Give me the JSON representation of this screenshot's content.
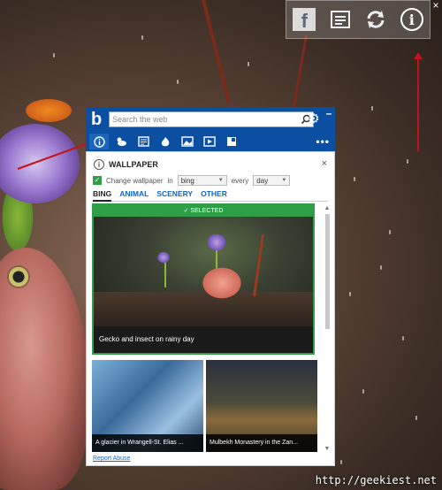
{
  "charm_bar": {
    "facebook_glyph": "f",
    "icons": [
      "facebook-icon",
      "news-icon",
      "refresh-icon",
      "info-icon"
    ],
    "close_glyph": "×"
  },
  "bing": {
    "logo_glyph": "b",
    "search_placeholder": "Search the web",
    "minimize_glyph": "–",
    "more_glyph": "•••",
    "toolbar_icons": [
      "info-icon",
      "weather-icon",
      "news-icon",
      "trending-icon",
      "images-icon",
      "videos-icon",
      "apps-icon"
    ]
  },
  "wallpaper": {
    "title": "WALLPAPER",
    "close_glyph": "×",
    "change_label": "Change wallpaper",
    "in_label": "in",
    "source_value": "bing",
    "every_label": "every",
    "frequency_value": "day",
    "tabs": [
      {
        "label": "BING"
      },
      {
        "label": "ANIMAL"
      },
      {
        "label": "SCENERY"
      },
      {
        "label": "OTHER"
      }
    ],
    "selected_label": "✓ SELECTED",
    "main_caption": "Gecko and insect on rainy day",
    "thumb1_caption": "A glacier in Wrangell-St. Elias ...",
    "thumb2_caption": "Mulbekh Monastery in the Zan...",
    "report_abuse": "Report Abuse"
  },
  "site_url": "http://geekiest.net",
  "colors": {
    "bing_blue": "#0a4fa2",
    "selected_green": "#2e9e47",
    "link_blue": "#1167c4",
    "annotation_red": "#c0141a"
  }
}
